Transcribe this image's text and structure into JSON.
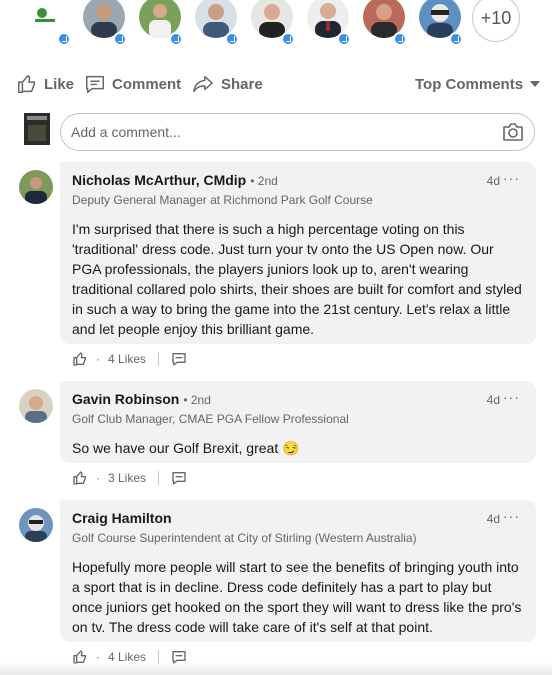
{
  "reactors": {
    "names": [
      "reactor-logo",
      "reactor-1",
      "reactor-2",
      "reactor-3",
      "reactor-4",
      "reactor-5",
      "reactor-6",
      "reactor-7"
    ],
    "more_label": "+10"
  },
  "social": {
    "like_label": "Like",
    "comment_label": "Comment",
    "share_label": "Share",
    "sort_label": "Top Comments"
  },
  "composer": {
    "placeholder": "Add a comment..."
  },
  "comments": [
    {
      "name": "Nicholas McArthur, CMdip",
      "degree": "• 2nd",
      "headline": "Deputy General Manager at Richmond Park Golf Course",
      "time": "4d",
      "menu": "···",
      "text": "I'm surprised that there is such a high percentage voting on this 'traditional' dress code. Just turn your tv onto the US Open now. Our PGA professionals, the players juniors look up to, aren't wearing traditional collared polo shirts, their shoes are built for comfort and styled in such a way to bring the game into the 21st century. Let's relax a little and let people enjoy this brilliant game.",
      "likes": "4 Likes",
      "dot": "·"
    },
    {
      "name": "Gavin Robinson",
      "degree": "• 2nd",
      "headline": "Golf Club Manager, CMAE PGA Fellow Professional",
      "time": "4d",
      "menu": "···",
      "text": "So we have our Golf Brexit, great 😏",
      "likes": "3 Likes",
      "dot": "·"
    },
    {
      "name": "Craig Hamilton",
      "degree": "",
      "headline": "Golf Course Superintendent at City of Stirling (Western Australia)",
      "time": "4d",
      "menu": "···",
      "text": "Hopefully more people will start to see the benefits of bringing youth into a sport that is in decline. Dress code definitely has a part to play but once juniors get hooked on the sport they will want to dress like the pro's on tv. The dress code will take care of it's self at that point.",
      "likes": "4 Likes",
      "dot": "·"
    }
  ],
  "colors": {
    "accent": "#378fe9",
    "bubble": "#f2f2f2",
    "muted": "#666666"
  }
}
